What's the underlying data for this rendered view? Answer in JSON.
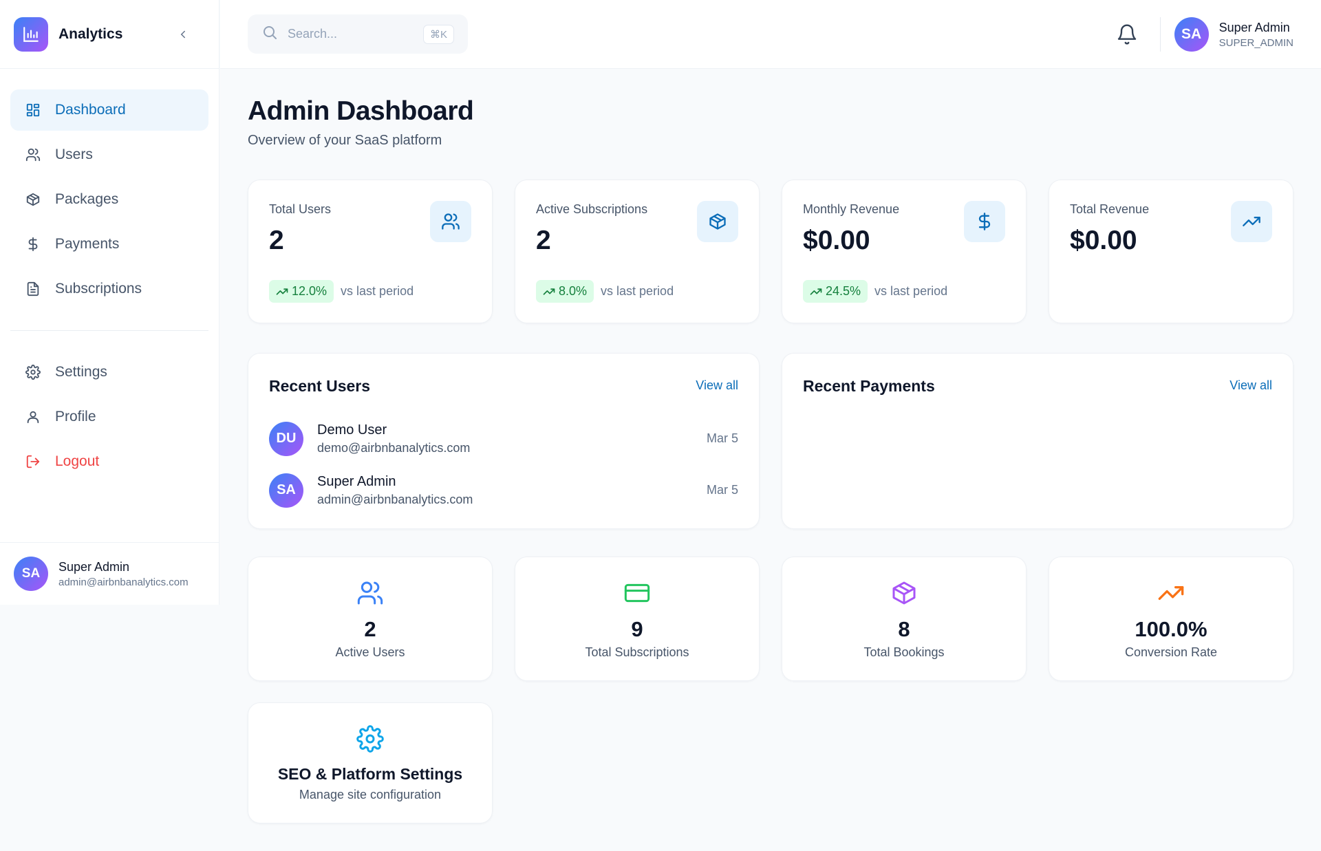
{
  "brand": {
    "name": "Analytics",
    "logo_icon": "bar-chart-icon"
  },
  "sidebar": {
    "items": [
      {
        "label": "Dashboard",
        "icon": "grid-icon",
        "active": true
      },
      {
        "label": "Users",
        "icon": "users-icon"
      },
      {
        "label": "Packages",
        "icon": "package-icon"
      },
      {
        "label": "Payments",
        "icon": "dollar-icon"
      },
      {
        "label": "Subscriptions",
        "icon": "file-icon"
      }
    ],
    "secondary": [
      {
        "label": "Settings",
        "icon": "gear-icon"
      },
      {
        "label": "Profile",
        "icon": "user-icon"
      },
      {
        "label": "Logout",
        "icon": "logout-icon"
      }
    ],
    "user": {
      "initials": "SA",
      "name": "Super Admin",
      "email": "admin@airbnbanalytics.com"
    }
  },
  "header": {
    "search": {
      "placeholder": "Search...",
      "shortcut": "⌘K"
    },
    "user": {
      "initials": "SA",
      "name": "Super Admin",
      "role": "SUPER_ADMIN"
    }
  },
  "page": {
    "title": "Admin Dashboard",
    "subtitle": "Overview of your SaaS platform"
  },
  "stats": [
    {
      "label": "Total Users",
      "value": "2",
      "icon": "users-icon",
      "trend": "12.0%",
      "trend_text": "vs last period"
    },
    {
      "label": "Active Subscriptions",
      "value": "2",
      "icon": "package-icon",
      "trend": "8.0%",
      "trend_text": "vs last period"
    },
    {
      "label": "Monthly Revenue",
      "value": "$0.00",
      "icon": "dollar-icon",
      "trend": "24.5%",
      "trend_text": "vs last period"
    },
    {
      "label": "Total Revenue",
      "value": "$0.00",
      "icon": "trending-up-icon"
    }
  ],
  "recent_users": {
    "title": "Recent Users",
    "link": "View all",
    "rows": [
      {
        "initials": "DU",
        "name": "Demo User",
        "email": "demo@airbnbanalytics.com",
        "date": "Mar 5"
      },
      {
        "initials": "SA",
        "name": "Super Admin",
        "email": "admin@airbnbanalytics.com",
        "date": "Mar 5"
      }
    ]
  },
  "recent_payments": {
    "title": "Recent Payments",
    "link": "View all"
  },
  "metrics": [
    {
      "value": "2",
      "label": "Active Users",
      "icon": "users-icon",
      "color": "#3b82f6"
    },
    {
      "value": "9",
      "label": "Total Subscriptions",
      "icon": "credit-card-icon",
      "color": "#22c55e"
    },
    {
      "value": "8",
      "label": "Total Bookings",
      "icon": "package-icon",
      "color": "#a855f7"
    },
    {
      "value": "100.0%",
      "label": "Conversion Rate",
      "icon": "trending-up-icon",
      "color": "#f97316"
    }
  ],
  "settings_card": {
    "title": "SEO & Platform Settings",
    "subtitle": "Manage site configuration",
    "icon": "gear-icon",
    "color": "#0ea5e9"
  },
  "colors": {
    "accent": "#0b6db8",
    "active_bg": "#eef6fd",
    "danger": "#ef4444",
    "trend_green": "#15803d"
  }
}
